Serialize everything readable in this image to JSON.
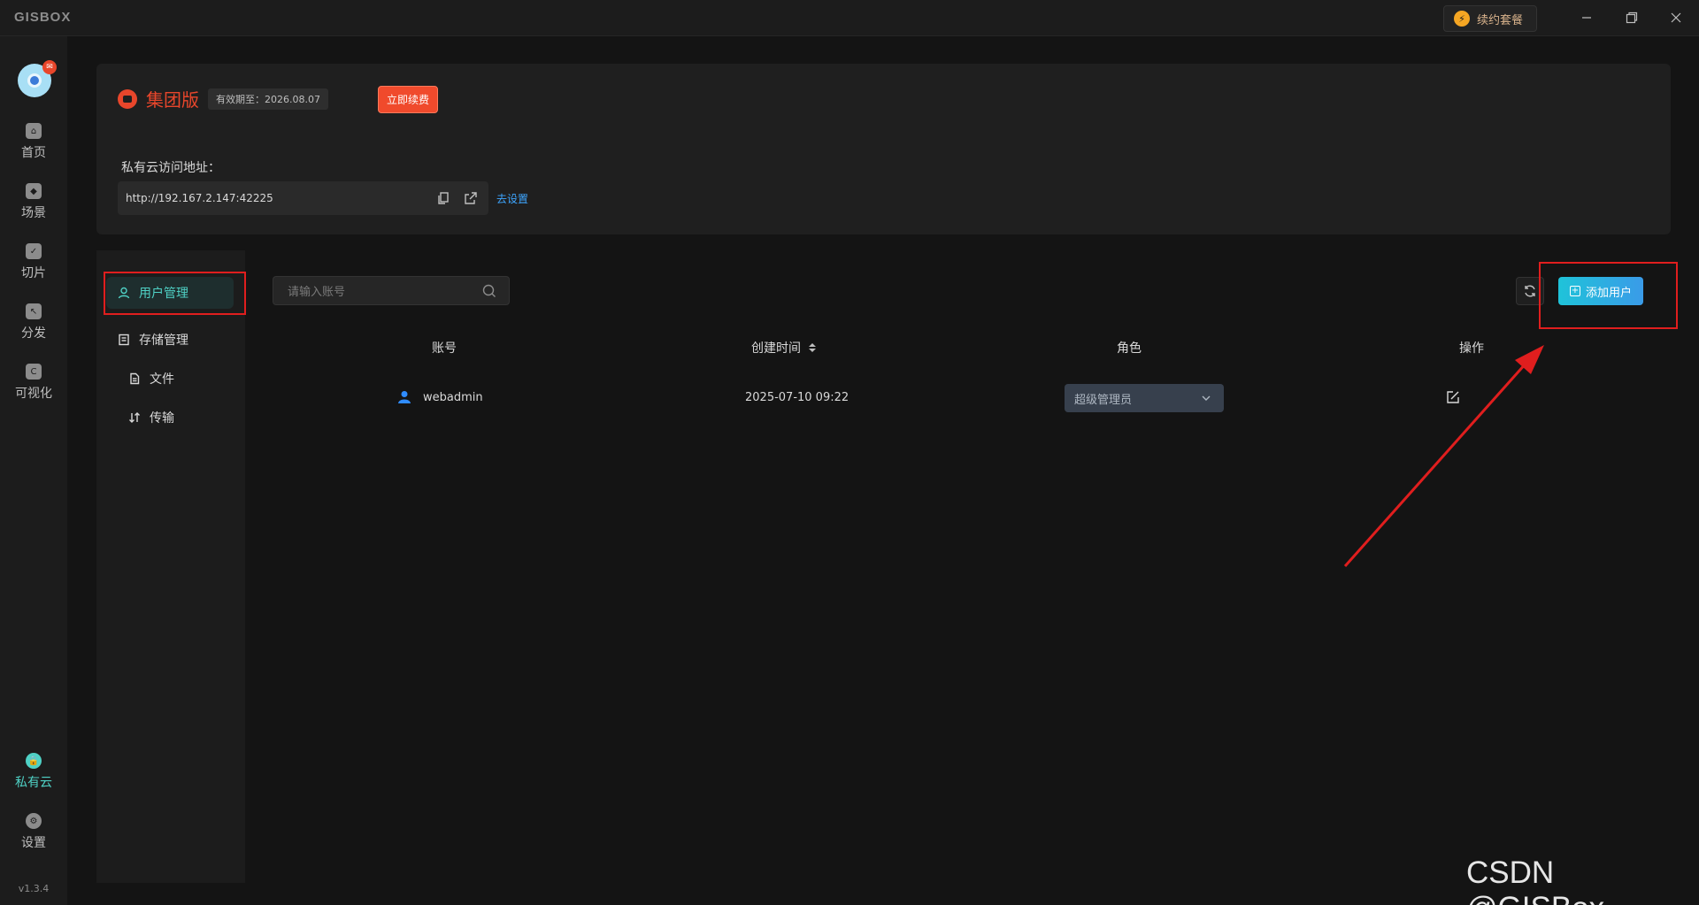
{
  "app": {
    "logo": "GISBOX",
    "version": "v1.3.4"
  },
  "titlebar": {
    "renew_label": "续约套餐"
  },
  "leftnav": {
    "items": [
      {
        "label": "首页",
        "icon": "home-icon"
      },
      {
        "label": "场景",
        "icon": "scene-icon"
      },
      {
        "label": "切片",
        "icon": "slice-icon"
      },
      {
        "label": "分发",
        "icon": "publish-icon"
      },
      {
        "label": "可视化",
        "icon": "visualize-icon"
      },
      {
        "label": "私有云",
        "icon": "private-cloud-icon",
        "active": true
      },
      {
        "label": "设置",
        "icon": "settings-icon"
      }
    ]
  },
  "license": {
    "edition": "集团版",
    "expiry": "有效期至：2026.08.07",
    "renew_button": "立即续费",
    "address_label": "私有云访问地址：",
    "address": "http://192.167.2.147:42225",
    "goto_settings": "去设置"
  },
  "subnav": {
    "user_mgmt": "用户管理",
    "storage_mgmt": "存储管理",
    "files": "文件",
    "transfer": "传输"
  },
  "search": {
    "placeholder": "请输入账号"
  },
  "toolbar": {
    "add_user": "添加用户"
  },
  "table": {
    "headers": {
      "account": "账号",
      "created": "创建时间",
      "role": "角色",
      "actions": "操作"
    },
    "rows": [
      {
        "account": "webadmin",
        "created": "2025-07-10 09:22",
        "role": "超级管理员"
      }
    ]
  },
  "watermark": "CSDN @GISBox",
  "colors": {
    "accent": "#4fd1c5",
    "brand_red": "#e8462b",
    "annotation_red": "#e01e1e",
    "link": "#3ea6ff"
  }
}
